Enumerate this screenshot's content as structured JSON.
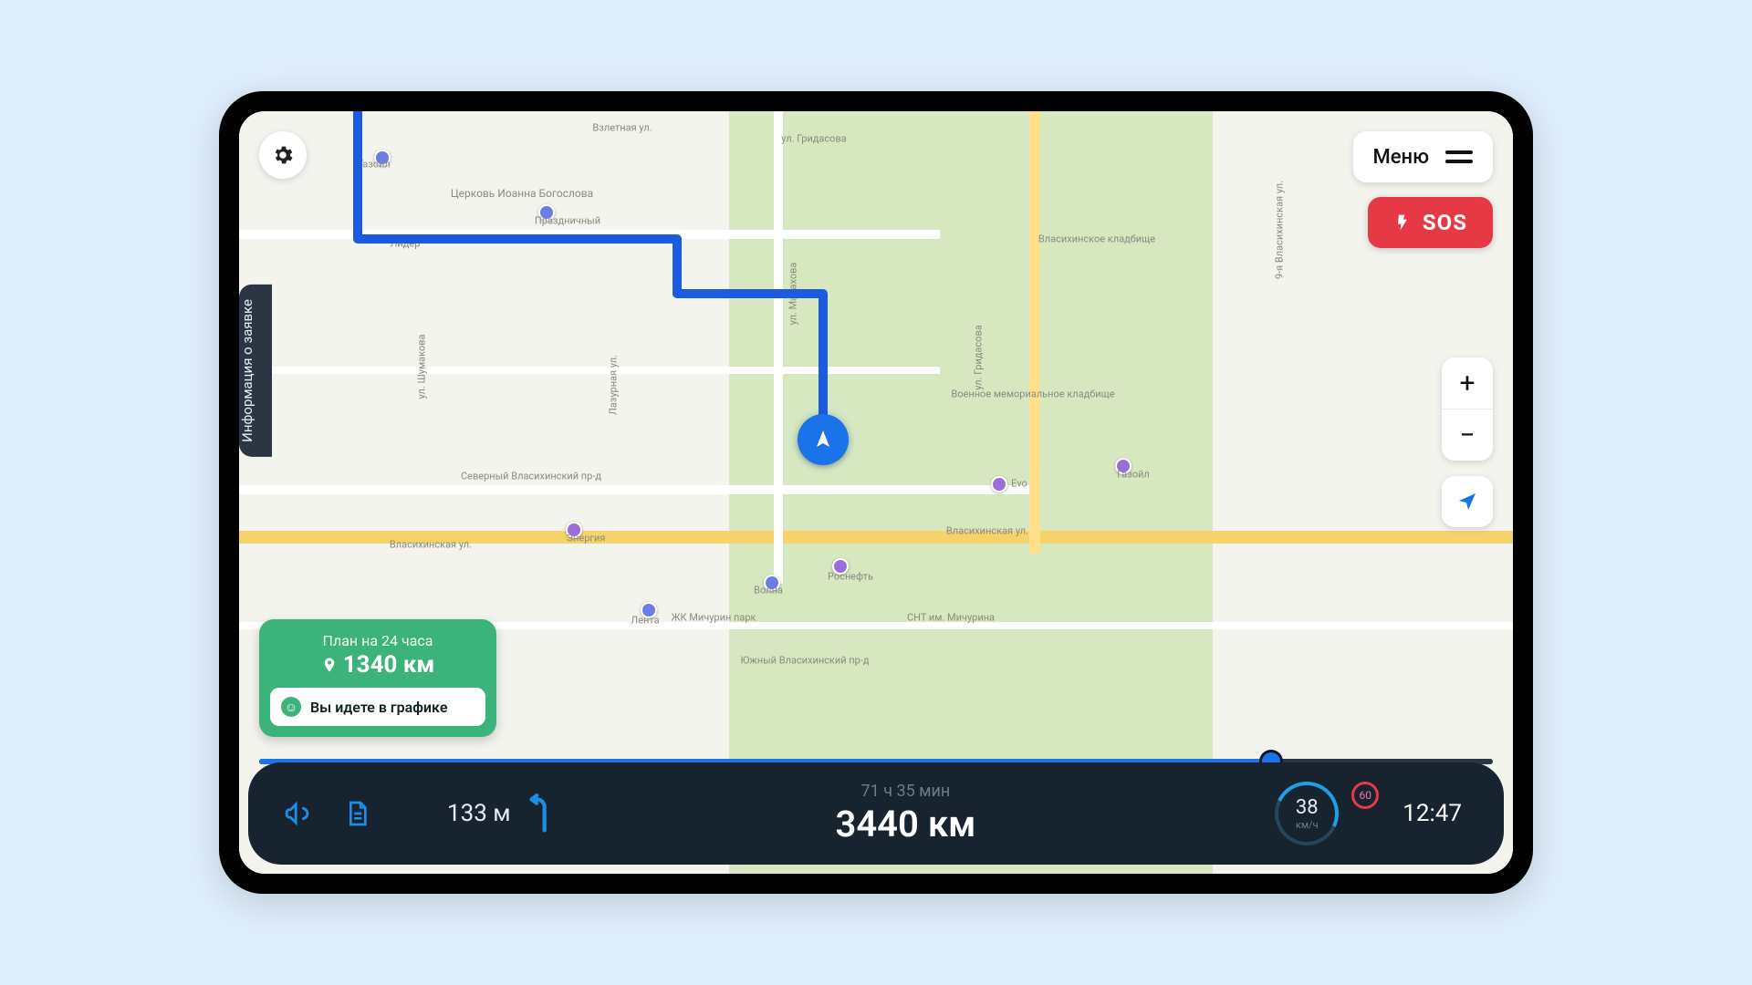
{
  "header": {
    "menu_label": "Меню",
    "sos_label": "SOS"
  },
  "side_tab": {
    "label": "Информация о заявке"
  },
  "plan_card": {
    "title": "План на 24 часа",
    "distance": "1340 км",
    "status_text": "Вы идете в графике"
  },
  "zoom": {
    "plus": "+",
    "minus": "−"
  },
  "dashboard": {
    "next_turn_distance": "133 м",
    "eta_time": "71 ч 35 мин",
    "total_distance": "3440 км",
    "speed_value": "38",
    "speed_unit": "км/ч",
    "speed_limit": "60",
    "clock": "12:47"
  },
  "progress": {
    "percent": 82
  },
  "map_labels": {
    "взлетная": "Взлетная ул.",
    "гридасова": "ул. Гридасова",
    "церковь": "Церковь Иоанна Богослова",
    "праздничный": "Праздничный",
    "газойл": "Газойл",
    "лидер": "Лидер",
    "шумакова": "ул. Шумакова",
    "лазурная": "Лазурная ул.",
    "малахова": "ул. Малахова",
    "северный": "Северный Власихинский пр-д",
    "власихинская": "Власихинская ул.",
    "власихинская2": "Власихинская ул.",
    "энергия": "Энергия",
    "лента": "Лента",
    "мичурин": "ЖК Мичурин парк",
    "волна": "Волна",
    "роснефть": "Роснефть",
    "снт": "СНТ им. Мичурина",
    "evo": "Evo",
    "власкладб": "Власихинское кладбище",
    "военкладб": "Военное мемориальное кладбище",
    "газойл2": "Газойл",
    "южный": "Южный Власихинский пр-д",
    "девятая": "9-я Власихинская ул.",
    "гридасова2": "ул. Гридасова"
  },
  "icons": {
    "gear": "gear-icon",
    "menu": "menu-icon",
    "bolt": "bolt-icon",
    "plus": "plus-icon",
    "minus": "minus-icon",
    "locate": "locate-arrow-icon",
    "pin": "pin-icon",
    "smile": "smile-icon",
    "megaphone": "megaphone-icon",
    "doc": "document-icon",
    "turn": "turn-left-icon",
    "nav": "navigation-arrow-icon"
  },
  "colors": {
    "accent": "#1a73e8",
    "danger": "#e63946",
    "ok": "#3cb37a",
    "dash": "#182330"
  }
}
